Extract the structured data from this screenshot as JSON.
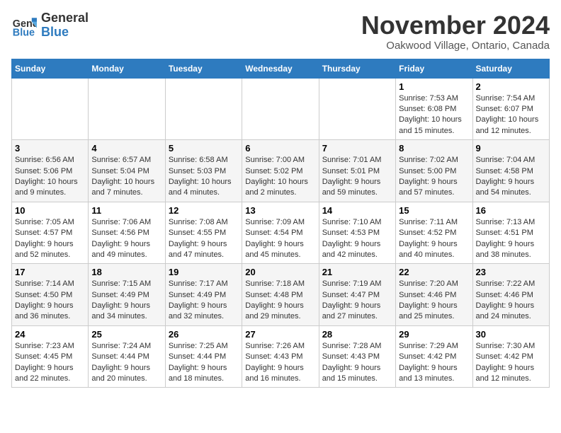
{
  "logo": {
    "line1": "General",
    "line2": "Blue"
  },
  "title": "November 2024",
  "location": "Oakwood Village, Ontario, Canada",
  "days_header": [
    "Sunday",
    "Monday",
    "Tuesday",
    "Wednesday",
    "Thursday",
    "Friday",
    "Saturday"
  ],
  "weeks": [
    [
      {
        "day": "",
        "info": ""
      },
      {
        "day": "",
        "info": ""
      },
      {
        "day": "",
        "info": ""
      },
      {
        "day": "",
        "info": ""
      },
      {
        "day": "",
        "info": ""
      },
      {
        "day": "1",
        "info": "Sunrise: 7:53 AM\nSunset: 6:08 PM\nDaylight: 10 hours and 15 minutes."
      },
      {
        "day": "2",
        "info": "Sunrise: 7:54 AM\nSunset: 6:07 PM\nDaylight: 10 hours and 12 minutes."
      }
    ],
    [
      {
        "day": "3",
        "info": "Sunrise: 6:56 AM\nSunset: 5:06 PM\nDaylight: 10 hours and 9 minutes."
      },
      {
        "day": "4",
        "info": "Sunrise: 6:57 AM\nSunset: 5:04 PM\nDaylight: 10 hours and 7 minutes."
      },
      {
        "day": "5",
        "info": "Sunrise: 6:58 AM\nSunset: 5:03 PM\nDaylight: 10 hours and 4 minutes."
      },
      {
        "day": "6",
        "info": "Sunrise: 7:00 AM\nSunset: 5:02 PM\nDaylight: 10 hours and 2 minutes."
      },
      {
        "day": "7",
        "info": "Sunrise: 7:01 AM\nSunset: 5:01 PM\nDaylight: 9 hours and 59 minutes."
      },
      {
        "day": "8",
        "info": "Sunrise: 7:02 AM\nSunset: 5:00 PM\nDaylight: 9 hours and 57 minutes."
      },
      {
        "day": "9",
        "info": "Sunrise: 7:04 AM\nSunset: 4:58 PM\nDaylight: 9 hours and 54 minutes."
      }
    ],
    [
      {
        "day": "10",
        "info": "Sunrise: 7:05 AM\nSunset: 4:57 PM\nDaylight: 9 hours and 52 minutes."
      },
      {
        "day": "11",
        "info": "Sunrise: 7:06 AM\nSunset: 4:56 PM\nDaylight: 9 hours and 49 minutes."
      },
      {
        "day": "12",
        "info": "Sunrise: 7:08 AM\nSunset: 4:55 PM\nDaylight: 9 hours and 47 minutes."
      },
      {
        "day": "13",
        "info": "Sunrise: 7:09 AM\nSunset: 4:54 PM\nDaylight: 9 hours and 45 minutes."
      },
      {
        "day": "14",
        "info": "Sunrise: 7:10 AM\nSunset: 4:53 PM\nDaylight: 9 hours and 42 minutes."
      },
      {
        "day": "15",
        "info": "Sunrise: 7:11 AM\nSunset: 4:52 PM\nDaylight: 9 hours and 40 minutes."
      },
      {
        "day": "16",
        "info": "Sunrise: 7:13 AM\nSunset: 4:51 PM\nDaylight: 9 hours and 38 minutes."
      }
    ],
    [
      {
        "day": "17",
        "info": "Sunrise: 7:14 AM\nSunset: 4:50 PM\nDaylight: 9 hours and 36 minutes."
      },
      {
        "day": "18",
        "info": "Sunrise: 7:15 AM\nSunset: 4:49 PM\nDaylight: 9 hours and 34 minutes."
      },
      {
        "day": "19",
        "info": "Sunrise: 7:17 AM\nSunset: 4:49 PM\nDaylight: 9 hours and 32 minutes."
      },
      {
        "day": "20",
        "info": "Sunrise: 7:18 AM\nSunset: 4:48 PM\nDaylight: 9 hours and 29 minutes."
      },
      {
        "day": "21",
        "info": "Sunrise: 7:19 AM\nSunset: 4:47 PM\nDaylight: 9 hours and 27 minutes."
      },
      {
        "day": "22",
        "info": "Sunrise: 7:20 AM\nSunset: 4:46 PM\nDaylight: 9 hours and 25 minutes."
      },
      {
        "day": "23",
        "info": "Sunrise: 7:22 AM\nSunset: 4:46 PM\nDaylight: 9 hours and 24 minutes."
      }
    ],
    [
      {
        "day": "24",
        "info": "Sunrise: 7:23 AM\nSunset: 4:45 PM\nDaylight: 9 hours and 22 minutes."
      },
      {
        "day": "25",
        "info": "Sunrise: 7:24 AM\nSunset: 4:44 PM\nDaylight: 9 hours and 20 minutes."
      },
      {
        "day": "26",
        "info": "Sunrise: 7:25 AM\nSunset: 4:44 PM\nDaylight: 9 hours and 18 minutes."
      },
      {
        "day": "27",
        "info": "Sunrise: 7:26 AM\nSunset: 4:43 PM\nDaylight: 9 hours and 16 minutes."
      },
      {
        "day": "28",
        "info": "Sunrise: 7:28 AM\nSunset: 4:43 PM\nDaylight: 9 hours and 15 minutes."
      },
      {
        "day": "29",
        "info": "Sunrise: 7:29 AM\nSunset: 4:42 PM\nDaylight: 9 hours and 13 minutes."
      },
      {
        "day": "30",
        "info": "Sunrise: 7:30 AM\nSunset: 4:42 PM\nDaylight: 9 hours and 12 minutes."
      }
    ]
  ]
}
